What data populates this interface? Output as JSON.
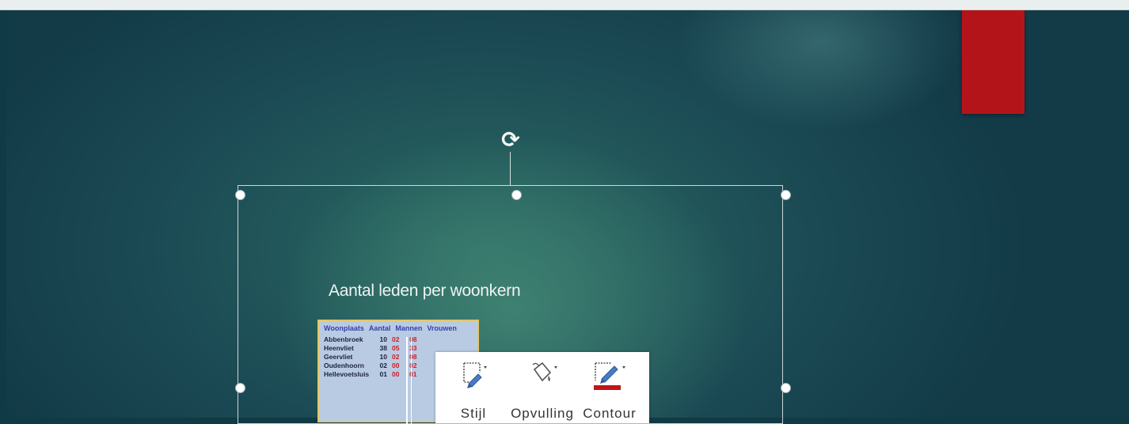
{
  "chart_title": "Aantal leden per woonkern",
  "table": {
    "headers": [
      "Woonplaats",
      "Aantal",
      "Mannen",
      "Vrouwen"
    ],
    "rows": [
      [
        "Abbenbroek",
        "10",
        "02",
        "08"
      ],
      [
        "Heenvliet",
        "38",
        "05",
        "33"
      ],
      [
        "Geervliet",
        "10",
        "02",
        "08"
      ],
      [
        "Oudenhoorn",
        "02",
        "00",
        "02"
      ],
      [
        "Hellevoetsluis",
        "01",
        "00",
        "01"
      ]
    ]
  },
  "mini_toolbar": {
    "style_label": "Stijl",
    "fill_label": "Opvulling",
    "outline_label": "Contour"
  },
  "icons": {
    "rotate": "rotate-handle-icon",
    "style": "shape-style-icon",
    "fill": "fill-bucket-icon",
    "outline": "pen-outline-icon"
  },
  "colors": {
    "accent_red": "#b3141a",
    "outline_color": "#c0141a"
  }
}
